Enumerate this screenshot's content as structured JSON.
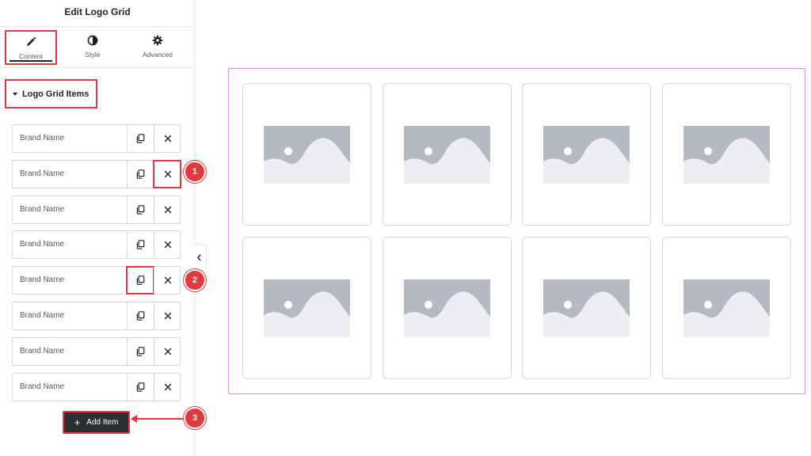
{
  "panel": {
    "title": "Edit Logo Grid",
    "tabs": [
      {
        "label": "Content",
        "icon": "pencil-icon",
        "active": true
      },
      {
        "label": "Style",
        "icon": "half-circle-icon",
        "active": false
      },
      {
        "label": "Advanced",
        "icon": "gear-icon",
        "active": false
      }
    ],
    "section": {
      "label": "Logo Grid Items",
      "expanded": true
    },
    "items": [
      {
        "title": "Brand Name"
      },
      {
        "title": "Brand Name"
      },
      {
        "title": "Brand Name"
      },
      {
        "title": "Brand Name"
      },
      {
        "title": "Brand Name"
      },
      {
        "title": "Brand Name"
      },
      {
        "title": "Brand Name"
      },
      {
        "title": "Brand Name"
      }
    ],
    "add_button_label": "Add Item"
  },
  "callouts": [
    "1",
    "2",
    "3"
  ],
  "canvas": {
    "logo_count": 8,
    "placeholder_icon": "image-placeholder-icon"
  },
  "colors": {
    "accent": "#e0393e",
    "canvas_border": "#e58fe5",
    "placeholder_bg": "#eceef1",
    "placeholder_fg": "#b4bac1",
    "dark_button": "#2b2e33"
  }
}
